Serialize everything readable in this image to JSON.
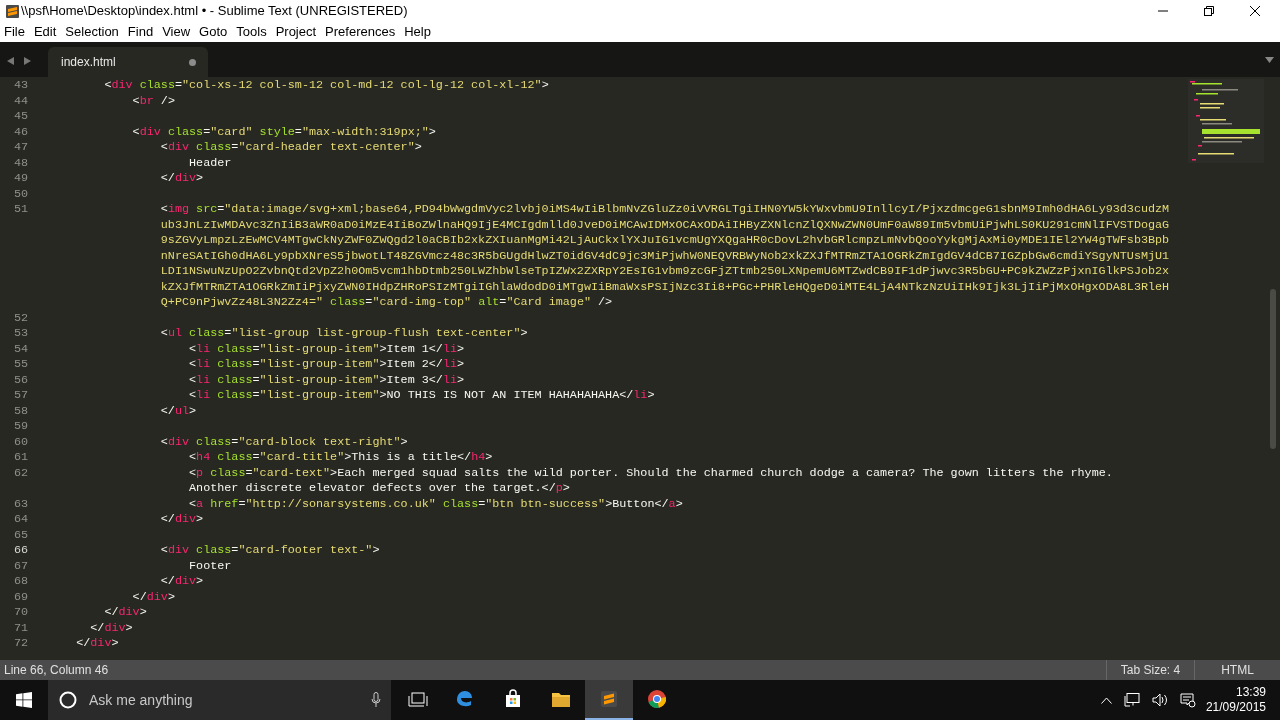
{
  "window": {
    "title": "\\\\psf\\Home\\Desktop\\index.html • - Sublime Text (UNREGISTERED)"
  },
  "menu": [
    "File",
    "Edit",
    "Selection",
    "Find",
    "View",
    "Goto",
    "Tools",
    "Project",
    "Preferences",
    "Help"
  ],
  "tabs": [
    {
      "label": "index.html",
      "selected": true,
      "modified": true
    }
  ],
  "editor": {
    "lines": [
      {
        "number": "43",
        "current": false,
        "rows": [
          "        <div class=\"col-xs-12 col-sm-12 col-md-12 col-lg-12 col-xl-12\">"
        ]
      },
      {
        "number": "44",
        "current": false,
        "rows": [
          "            <br />"
        ]
      },
      {
        "number": "45",
        "current": false
      },
      {
        "number": "46",
        "current": false,
        "rows": [
          "            <div class=\"card\" style=\"max-width:319px;\">"
        ]
      },
      {
        "number": "47",
        "current": false,
        "rows": [
          "                <div class=\"card-header text-center\">"
        ]
      },
      {
        "number": "48",
        "current": false,
        "rows": [
          "                    Header"
        ]
      },
      {
        "number": "49",
        "current": false,
        "rows": [
          "                </div>"
        ]
      },
      {
        "number": "50",
        "current": false
      },
      {
        "number": "51",
        "current": false,
        "rows": [
          "                <img src=\"data:image/svg+xml;base64,PD94bWwgdmVyc2lvbj0iMS4wIiBlbmNvZGluZz0iVVRGLTgiIHN0YW5kYWxvbmU9InllcyI/PjxzdmcgeG1sbnM9Imh0dHA6Ly93d3cudzM",
          "                ub3JnLzIwMDAvc3ZnIiB3aWR0aD0iMzE4IiBoZWlnaHQ9IjE4MCIgdmlld0JveD0iMCAwIDMxOCAxODAiIHByZXNlcnZlQXNwZWN0UmF0aW89Im5vbmUiPjwhLS0KU291cmNlIFVSTDogaG",
          "                9sZGVyLmpzLzEwMCV4MTgwCkNyZWF0ZWQgd2l0aCBIb2xkZXIuanMgMi42LjAuCkxlYXJuIG1vcmUgYXQgaHR0cDovL2hvbGRlcmpzLmNvbQooYykgMjAxMi0yMDE1IEl2YW4gTWFsb3Bpb",
          "                nNreSAtIGh0dHA6Ly9pbXNreS5jbwotLT48ZGVmcz48c3R5bGUgdHlwZT0idGV4dC9jc3MiPjwhW0NEQVRBWyNob2xkZXJfMTRmZTA1OGRkZmIgdGV4dCB7IGZpbGw6cmdiYSgyNTUsMjU1",
          "                LDI1NSwuNzUpO2ZvbnQtd2VpZ2h0Om5vcm1hbDtmb250LWZhbWlseTpIZWx2ZXRpY2EsIG1vbm9zcGFjZTtmb250LXNpemU6MTZwdCB9IF1dPjwvc3R5bGU+PC9kZWZzPjxnIGlkPSJob2x",
          "                kZXJfMTRmZTA1OGRkZmIiPjxyZWN0IHdpZHRoPSIzMTgiIGhlaWdodD0iMTgwIiBmaWxsPSIjNzc3Ii8+PGc+PHRleHQgeD0iMTE4LjA4NTkzNzUiIHk9Ijk3LjIiPjMxOHgxODA8L3RleH",
          "                Q+PC9nPjwvZz48L3N2Zz4=\" class=\"card-img-top\" alt=\"Card image\" />"
        ]
      },
      {
        "number": "52",
        "current": false
      },
      {
        "number": "53",
        "current": false,
        "rows": [
          "                <ul class=\"list-group list-group-flush text-center\">"
        ]
      },
      {
        "number": "54",
        "current": false,
        "rows": [
          "                    <li class=\"list-group-item\">Item 1</li>"
        ]
      },
      {
        "number": "55",
        "current": false,
        "rows": [
          "                    <li class=\"list-group-item\">Item 2</li>"
        ]
      },
      {
        "number": "56",
        "current": false,
        "rows": [
          "                    <li class=\"list-group-item\">Item 3</li>"
        ]
      },
      {
        "number": "57",
        "current": false,
        "rows": [
          "                    <li class=\"list-group-item\">NO THIS IS NOT AN ITEM HAHAHAHAHA</li>"
        ]
      },
      {
        "number": "58",
        "current": false,
        "rows": [
          "                </ul>"
        ]
      },
      {
        "number": "59",
        "current": false
      },
      {
        "number": "60",
        "current": false,
        "rows": [
          "                <div class=\"card-block text-right\">"
        ]
      },
      {
        "number": "61",
        "current": false,
        "rows": [
          "                    <h4 class=\"card-title\">This is a title</h4>"
        ]
      },
      {
        "number": "62",
        "current": false,
        "rows": [
          "                    <p class=\"card-text\">Each merged squad salts the wild porter. Should the charmed church dodge a camera? The gown litters the rhyme.",
          "                    Another discrete elevator defects over the target.</p>"
        ]
      },
      {
        "number": "63",
        "current": false,
        "rows": [
          "                    <a href=\"http://sonarsystems.co.uk\" class=\"btn btn-success\">Button</a>"
        ]
      },
      {
        "number": "64",
        "current": false,
        "rows": [
          "                </div>"
        ]
      },
      {
        "number": "65",
        "current": false
      },
      {
        "number": "66",
        "current": true,
        "rows": [
          "                <div class=\"card-footer text-\">"
        ]
      },
      {
        "number": "67",
        "current": false,
        "rows": [
          "                    Footer"
        ]
      },
      {
        "number": "68",
        "current": false,
        "rows": [
          "                </div>"
        ]
      },
      {
        "number": "69",
        "current": false,
        "rows": [
          "            </div>"
        ]
      },
      {
        "number": "70",
        "current": false,
        "rows": [
          "        </div>"
        ]
      },
      {
        "number": "71",
        "current": false,
        "rows": [
          "      </div>"
        ]
      },
      {
        "number": "72",
        "current": false,
        "rows": [
          "    </div>"
        ]
      }
    ]
  },
  "status_bar": {
    "position": "Line 66, Column 46",
    "tab_size": "Tab Size: 4",
    "syntax": "HTML"
  },
  "taskbar": {
    "search_placeholder": "Ask me anything",
    "apps": [
      {
        "kind": "edge",
        "active": false
      },
      {
        "kind": "store",
        "active": false
      },
      {
        "kind": "explorer",
        "active": false
      },
      {
        "kind": "sublime",
        "active": true
      },
      {
        "kind": "chrome",
        "active": false
      }
    ],
    "time": "13:39",
    "date": "21/09/2015"
  }
}
